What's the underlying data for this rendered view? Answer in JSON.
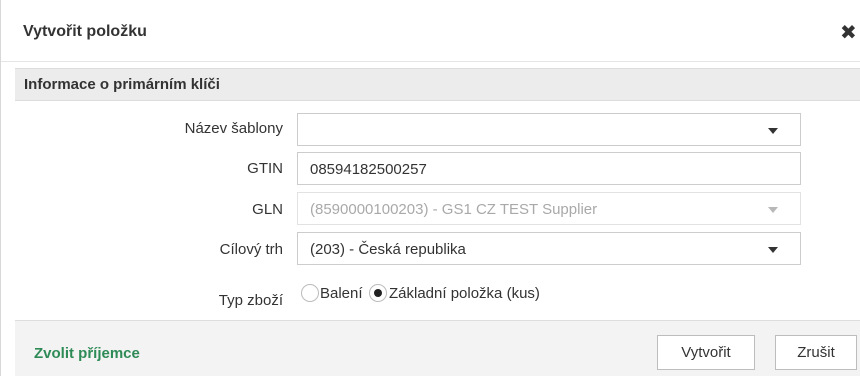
{
  "dialog": {
    "title": "Vytvořit položku",
    "close_symbol": "✖"
  },
  "section": {
    "title": "Informace o primárním klíči"
  },
  "form": {
    "template_name": {
      "label": "Název šablony",
      "value": ""
    },
    "gtin": {
      "label": "GTIN",
      "value": "08594182500257"
    },
    "gln": {
      "label": "GLN",
      "value": "(8590000100203) - GS1 CZ TEST Supplier",
      "disabled": true
    },
    "target_market": {
      "label": "Cílový trh",
      "value": "(203) - Česká republika"
    },
    "item_type": {
      "label": "Typ zboží",
      "options": [
        {
          "label": "Balení",
          "selected": false
        },
        {
          "label": "Základní položka (kus)",
          "selected": true
        }
      ]
    }
  },
  "footer": {
    "choose_recipient": "Zvolit příjemce",
    "create_button": "Vytvořit",
    "cancel_button": "Zrušit"
  },
  "colors": {
    "link_green": "#2e8b57",
    "section_bg": "#ececec",
    "footer_bg": "#f3f3f3"
  },
  "icons": [
    "close-icon",
    "dropdown-caret-icon",
    "radio-icon"
  ]
}
